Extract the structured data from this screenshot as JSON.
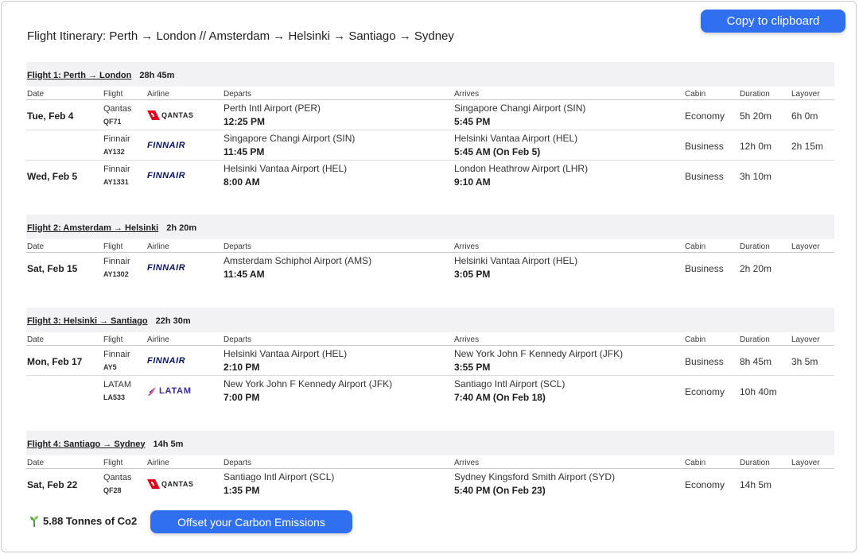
{
  "header": {
    "title": "Flight Itinerary: Perth → London // Amsterdam → Helsinki → Santiago → Sydney",
    "copy_label": "Copy to clipboard"
  },
  "columns": {
    "date": "Date",
    "flight": "Flight",
    "airline": "Airline",
    "departs": "Departs",
    "arrives": "Arrives",
    "cabin": "Cabin",
    "duration": "Duration",
    "layover": "Layover"
  },
  "logos": {
    "qantas": "QANTAS",
    "finnair": "FINNAIR",
    "latam": "LATAM"
  },
  "colors": {
    "accent": "#2f6ff0",
    "qantas_red": "#e0001b",
    "finnair_navy": "#0b1560",
    "latam_purple": "#3b2a8c",
    "latam_pink": "#e3165b"
  },
  "sections": [
    {
      "route": "Flight 1: Perth → London",
      "total": "28h 45m",
      "rows": [
        {
          "date": "Tue, Feb 4",
          "airline": "Qantas",
          "code": "QF71",
          "logo": "qantas",
          "dep_airport": "Perth Intl Airport (PER)",
          "dep_time": "12:25 PM",
          "arr_airport": "Singapore Changi Airport (SIN)",
          "arr_time": "5:45 PM",
          "cabin": "Economy",
          "duration": "5h 20m",
          "layover": "6h 0m"
        },
        {
          "date": "",
          "airline": "Finnair",
          "code": "AY132",
          "logo": "finnair",
          "dep_airport": "Singapore Changi Airport (SIN)",
          "dep_time": "11:45 PM",
          "arr_airport": "Helsinki Vantaa Airport (HEL)",
          "arr_time": "5:45 AM (On Feb 5)",
          "cabin": "Business",
          "duration": "12h 0m",
          "layover": "2h 15m"
        },
        {
          "date": "Wed, Feb 5",
          "airline": "Finnair",
          "code": "AY1331",
          "logo": "finnair",
          "dep_airport": "Helsinki Vantaa Airport (HEL)",
          "dep_time": "8:00 AM",
          "arr_airport": "London Heathrow Airport (LHR)",
          "arr_time": "9:10 AM",
          "cabin": "Business",
          "duration": "3h 10m",
          "layover": ""
        }
      ]
    },
    {
      "route": "Flight 2: Amsterdam → Helsinki",
      "total": "2h 20m",
      "rows": [
        {
          "date": "Sat, Feb 15",
          "airline": "Finnair",
          "code": "AY1302",
          "logo": "finnair",
          "dep_airport": "Amsterdam Schiphol Airport (AMS)",
          "dep_time": "11:45 AM",
          "arr_airport": "Helsinki Vantaa Airport (HEL)",
          "arr_time": "3:05 PM",
          "cabin": "Business",
          "duration": "2h 20m",
          "layover": ""
        }
      ]
    },
    {
      "route": "Flight 3: Helsinki → Santiago",
      "total": "22h 30m",
      "rows": [
        {
          "date": "Mon, Feb 17",
          "airline": "Finnair",
          "code": "AY5",
          "logo": "finnair",
          "dep_airport": "Helsinki Vantaa Airport (HEL)",
          "dep_time": "2:10 PM",
          "arr_airport": "New York John F Kennedy Airport (JFK)",
          "arr_time": "3:55 PM",
          "cabin": "Business",
          "duration": "8h 45m",
          "layover": "3h 5m"
        },
        {
          "date": "",
          "airline": "LATAM",
          "code": "LA533",
          "logo": "latam",
          "dep_airport": "New York John F Kennedy Airport (JFK)",
          "dep_time": "7:00 PM",
          "arr_airport": "Santiago Intl Airport (SCL)",
          "arr_time": "7:40 AM (On Feb 18)",
          "cabin": "Economy",
          "duration": "10h 40m",
          "layover": ""
        }
      ]
    },
    {
      "route": "Flight 4: Santiago → Sydney",
      "total": "14h 5m",
      "rows": [
        {
          "date": "Sat, Feb 22",
          "airline": "Qantas",
          "code": "QF28",
          "logo": "qantas",
          "dep_airport": "Santiago Intl Airport (SCL)",
          "dep_time": "1:35 PM",
          "arr_airport": "Sydney Kingsford Smith Airport (SYD)",
          "arr_time": "5:40 PM (On Feb 23)",
          "cabin": "Economy",
          "duration": "14h 5m",
          "layover": ""
        }
      ]
    }
  ],
  "footer": {
    "co2_icon": "seedling-icon",
    "co2_text": "5.88 Tonnes of Co2",
    "offset_label": "Offset your Carbon Emissions"
  }
}
